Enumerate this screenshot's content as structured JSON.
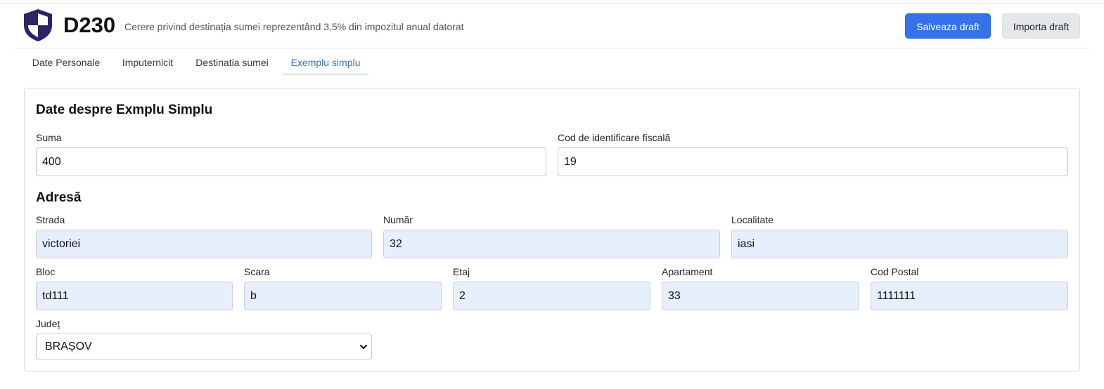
{
  "app": {
    "title": "D230",
    "subtitle": "Cerere privind destinația sumei reprezentând 3,5% din impozitul anual datorat",
    "logo_icon": "shield-icon"
  },
  "header": {
    "save_draft_label": "Salveaza draft",
    "import_draft_label": "Importa draft"
  },
  "tabs": [
    {
      "label": "Date Personale",
      "active": false
    },
    {
      "label": "Imputernicit",
      "active": false
    },
    {
      "label": "Destinatia sumei",
      "active": false
    },
    {
      "label": "Exemplu simplu",
      "active": true
    }
  ],
  "form": {
    "section_title": "Date despre Exmplu Simplu",
    "suma": {
      "label": "Suma",
      "value": "400"
    },
    "cif": {
      "label": "Cod de identificare fiscală",
      "value": "19"
    },
    "address_title": "Adresă",
    "strada": {
      "label": "Strada",
      "value": "victoriei"
    },
    "numar": {
      "label": "Număr",
      "value": "32"
    },
    "localitate": {
      "label": "Localitate",
      "value": "iasi"
    },
    "bloc": {
      "label": "Bloc",
      "value": "td111"
    },
    "scara": {
      "label": "Scara",
      "value": "b"
    },
    "etaj": {
      "label": "Etaj",
      "value": "2"
    },
    "apartament": {
      "label": "Apartament",
      "value": "33"
    },
    "cod_postal": {
      "label": "Cod Postal",
      "value": "1111111"
    },
    "judet": {
      "label": "Județ",
      "value": "BRAȘOV",
      "icon": "chevron-down-icon"
    }
  },
  "colors": {
    "primary": "#3571e8",
    "active_tab": "#3b6fd8",
    "filled_field": "#e8effc",
    "logo_dark": "#2d2466"
  }
}
